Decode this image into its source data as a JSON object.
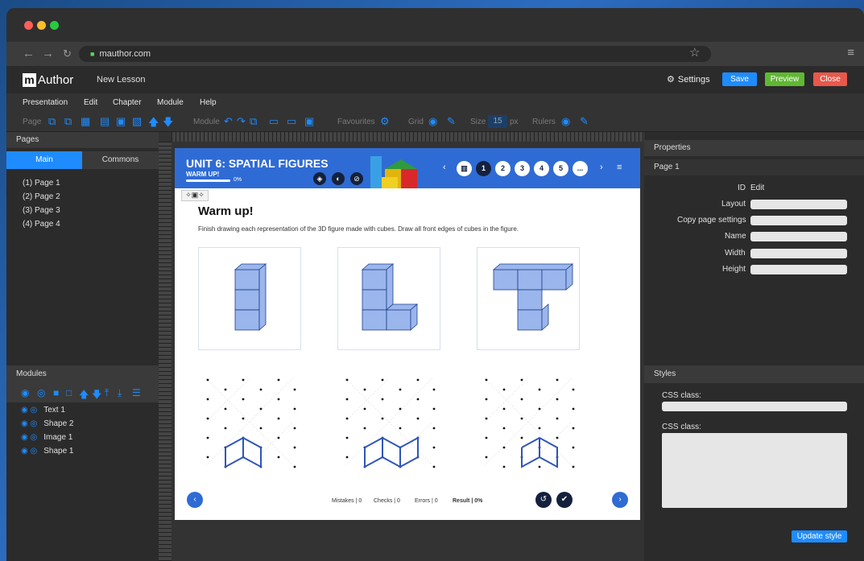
{
  "browser": {
    "url": "mauthor.com"
  },
  "app": {
    "logo_m": "m",
    "logo_text": "Author",
    "lesson_name": "New Lesson",
    "settings_label": "Settings",
    "save_label": "Save",
    "preview_label": "Preview",
    "close_label": "Close",
    "colors": {
      "save": "#1e8cff",
      "preview": "#5fb832",
      "close": "#e8584b",
      "accent": "#1e8cff"
    }
  },
  "menu": [
    "Presentation",
    "Edit",
    "Chapter",
    "Module",
    "Help"
  ],
  "toolbar": {
    "page_label": "Page",
    "module_label": "Module",
    "favourites_label": "Favourites",
    "grid_label": "Grid",
    "size_label": "Size",
    "size_value": "15",
    "size_unit": "px",
    "rulers_label": "Rulers"
  },
  "pages_panel": {
    "title": "Pages",
    "tab_main": "Main",
    "tab_commons": "Commons",
    "items": [
      "(1) Page 1",
      "(2) Page 2",
      "(3) Page 3",
      "(4) Page 4"
    ]
  },
  "modules_panel": {
    "title": "Modules",
    "items": [
      "Text 1",
      "Shape 2",
      "Image 1",
      "Shape 1"
    ]
  },
  "lesson_page": {
    "unit_title": "UNIT 6: SPATIAL FIGURES",
    "unit_sub": "WARM UP!",
    "progress_pct": "0%",
    "progress_value": 0,
    "pagination": [
      "1",
      "2",
      "3",
      "4",
      "5",
      "..."
    ],
    "heading": "Warm up!",
    "instruction": "Finish drawing each representation of the 3D figure made with cubes. Draw all front edges of cubes in the figure.",
    "mistakes": "Mistakes | 0",
    "checks": "Checks | 0",
    "errors": "Errors | 0",
    "result": "Result | 0%"
  },
  "properties_panel": {
    "title": "Properties",
    "subtitle": "Page 1",
    "id_label": "ID",
    "id_value": "Edit",
    "fields": [
      "Layout",
      "Copy page settings",
      "Name",
      "Width",
      "Height"
    ]
  },
  "styles_panel": {
    "title": "Styles",
    "css_class_label_1": "CSS class:",
    "css_class_label_2": "CSS class:",
    "update_label": "Update style"
  }
}
